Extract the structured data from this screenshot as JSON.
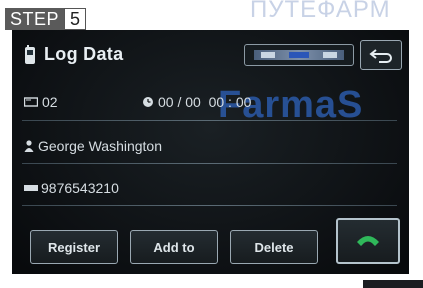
{
  "step": {
    "label": "STEP",
    "number": "5"
  },
  "watermark": {
    "top_text": "ПУТЕФАРМ",
    "center_text": "FarmaS"
  },
  "header": {
    "title": "Log Data",
    "status_text": ""
  },
  "entry": {
    "phonebook_index": "02",
    "datetime": "00 / 00  00 : 00",
    "name": "George Washington",
    "number": "9876543210"
  },
  "buttons": {
    "register": "Register",
    "add_to": "Add to",
    "delete": "Delete"
  },
  "colors": {
    "screen_bg": "#0d1013",
    "text": "#d6dde2",
    "call_green": "#2fb85a",
    "watermark_blue": "#2b5aa9"
  },
  "icons": {
    "back": "back-arrow-icon",
    "call": "phone-handset-icon",
    "book": "phonebook-icon",
    "clock": "clock-icon",
    "person": "person-icon",
    "phone": "phone-number-icon"
  }
}
